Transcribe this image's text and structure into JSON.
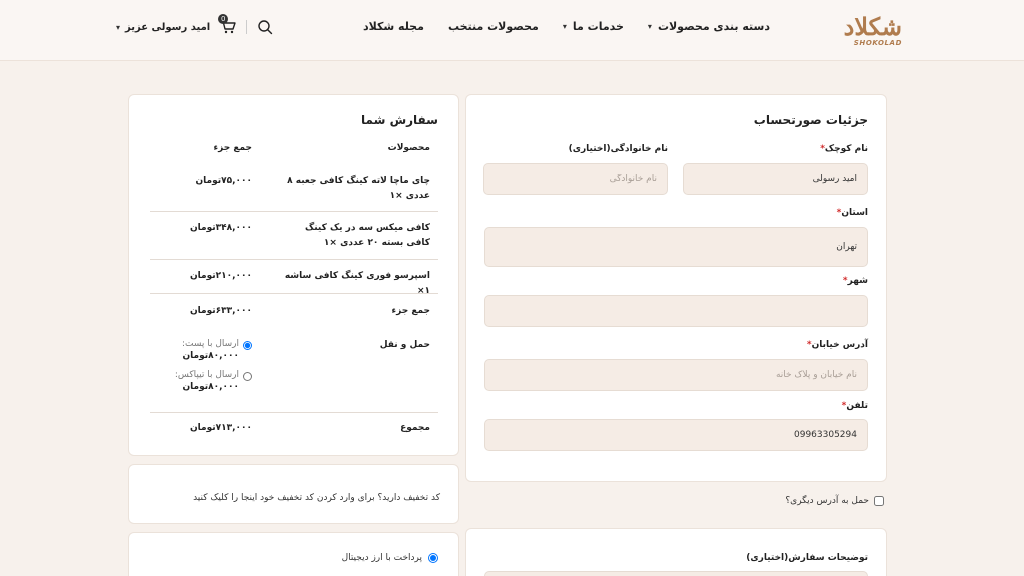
{
  "header": {
    "logo_text": "شکلاد",
    "logo_sub": "SHOKOLAD",
    "nav": [
      {
        "label": "دسته بندی محصولات",
        "has_dropdown": true
      },
      {
        "label": "خدمات ما",
        "has_dropdown": true
      },
      {
        "label": "محصولات منتخب",
        "has_dropdown": false
      },
      {
        "label": "مجله شکلاد",
        "has_dropdown": false
      }
    ],
    "user_name": "امید رسولی عزیز",
    "cart_count": "0"
  },
  "billing": {
    "title": "جزئیات صورتحساب",
    "first_name": {
      "label": "نام کوچک",
      "value": "امید رسولی"
    },
    "last_name": {
      "label": "نام خانوادگی(اختیاری)",
      "placeholder": "نام خانوادگی"
    },
    "province": {
      "label": "استان",
      "value": "تهران"
    },
    "city": {
      "label": "شهر",
      "value": ""
    },
    "address": {
      "label": "آدرس خیابان",
      "placeholder": "نام خیابان و پلاک خانه"
    },
    "phone": {
      "label": "تلفن",
      "value": "09963305294"
    },
    "ship_other_label": "حمل به آدرس دیگری؟"
  },
  "order": {
    "title": "سفارش شما",
    "col_products": "محصولات",
    "col_subtotal": "جمع جزء",
    "items": [
      {
        "name": "چای ماچا لاته کینگ کافی جعبه ۸ عددی ×۱",
        "price": "۷۵,۰۰۰تومان"
      },
      {
        "name": "کافی میکس سه در یک کینگ کافی بسته ۲۰ عددی ×۱",
        "price": "۳۴۸,۰۰۰تومان"
      },
      {
        "name": "اسپرسو فوری کینگ کافی ساشه ۱×",
        "price": "۲۱۰,۰۰۰تومان"
      }
    ],
    "subtotal_label": "جمع جزء",
    "subtotal_value": "۶۳۳,۰۰۰تومان",
    "shipping_label": "حمل و نقل",
    "shipping_options": [
      {
        "label": "ارسال با پست:",
        "price": "۸۰,۰۰۰تومان",
        "selected": true
      },
      {
        "label": "ارسال با تیپاکس:",
        "price": "۸۰,۰۰۰تومان",
        "selected": false
      }
    ],
    "total_label": "مجموع",
    "total_value": "۷۱۳,۰۰۰تومان"
  },
  "coupon": {
    "text": "کد تخفیف دارید؟ برای وارد کردن کد تخفیف خود اینجا را کلیک کنید"
  },
  "payment": {
    "option_label": "پرداخت با ارز دیجیتال"
  },
  "notes": {
    "label": "توضیحات سفارش(اختیاری)"
  },
  "colors": {
    "page_bg": "#f7f1ec",
    "field_bg": "#f5ece5",
    "brand": "#b07c4e",
    "required": "#d12c2c"
  }
}
